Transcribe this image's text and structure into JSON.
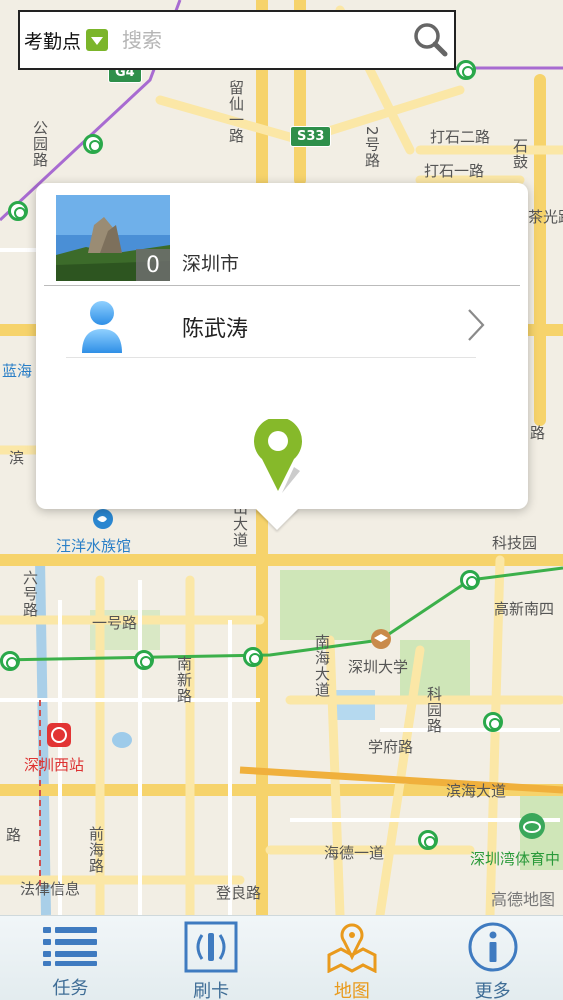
{
  "search": {
    "category_label": "考勤点",
    "placeholder": "搜索"
  },
  "map": {
    "watermark": "高德地图",
    "labels": {
      "road_gongyuan": "公园路",
      "road_liuxian1": "留仙一路",
      "road_2hao": "2号路",
      "road_dashi2": "打石二路",
      "road_dashi1": "打石一路",
      "road_shigu": "石鼓",
      "road_chaguang": "茶光路",
      "road_lanhai": "蓝海",
      "road_bin": "滨",
      "road_lu": "路",
      "road_shan": "山大道",
      "road_kejiyuan": "科技园",
      "poi_wangyang": "汪洋水族馆",
      "road_liuhao": "六号路",
      "road_1hao": "一号路",
      "road_gaoxin": "高新南四",
      "road_nanxin": "南新路",
      "road_nanhai": "南海大道",
      "poi_szu": "深圳大学",
      "road_keyuan": "科园路",
      "road_xuefu": "学府路",
      "poi_szwest": "深圳西站",
      "road_binhai": "滨海大道",
      "road_qianhai": "前海路",
      "road_haide": "海德一道",
      "poi_stadium": "深圳湾体育中",
      "poi_law": "法律信息",
      "road_dengliang": "登良路",
      "road_lu2": "路",
      "shield_g4": "G4",
      "shield_s33": "S33"
    }
  },
  "popup": {
    "location": "深圳市",
    "photo_count": "0",
    "person_name": "陈武涛"
  },
  "tabs": [
    {
      "label": "任务",
      "icon": "list-icon"
    },
    {
      "label": "刷卡",
      "icon": "card-swipe-icon"
    },
    {
      "label": "地图",
      "icon": "map-pin-icon",
      "active": true
    },
    {
      "label": "更多",
      "icon": "info-icon"
    }
  ],
  "colors": {
    "accent_active": "#e99a1c",
    "tab_text": "#3f6d96",
    "pin_green": "#86b92a",
    "metro_green": "#2aa84a"
  }
}
